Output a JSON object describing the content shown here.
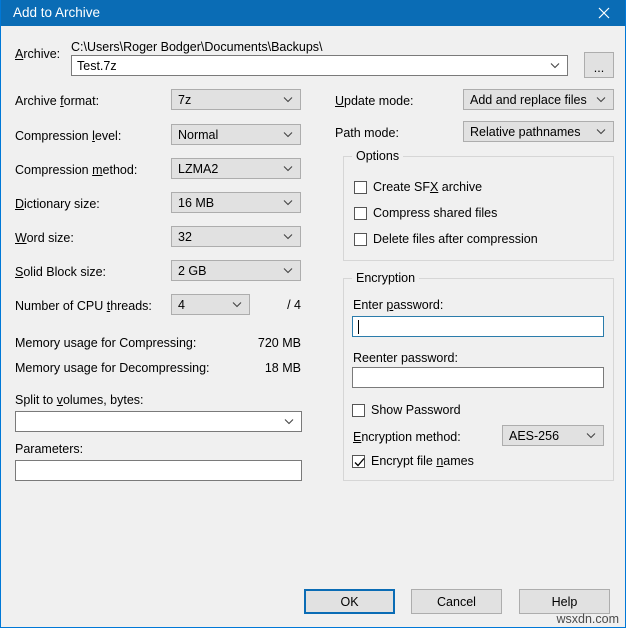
{
  "window": {
    "title": "Add to Archive",
    "close_icon": "close-icon"
  },
  "archive": {
    "label": "Archive:",
    "label_accel": "A",
    "path_text": "C:\\Users\\Roger Bodger\\Documents\\Backups\\",
    "name_value": "Test.7z",
    "browse_label": "..."
  },
  "left_fields": [
    {
      "label_pre": "Archive ",
      "label_accel": "f",
      "label_post": "ormat:",
      "value": "7z"
    },
    {
      "label_pre": "Compression ",
      "label_accel": "l",
      "label_post": "evel:",
      "value": "Normal"
    },
    {
      "label_pre": "Compression ",
      "label_accel": "m",
      "label_post": "ethod:",
      "value": "LZMA2"
    },
    {
      "label_pre": "",
      "label_accel": "D",
      "label_post": "ictionary size:",
      "value": "16 MB"
    },
    {
      "label_pre": "",
      "label_accel": "W",
      "label_post": "ord size:",
      "value": "32"
    },
    {
      "label_pre": "",
      "label_accel": "S",
      "label_post": "olid Block size:",
      "value": "2 GB"
    }
  ],
  "cpu": {
    "label_pre": "Number of CPU ",
    "label_accel": "t",
    "label_post": "hreads:",
    "value": "4",
    "total": "/ 4"
  },
  "memory": {
    "compress_label": "Memory usage for Compressing:",
    "compress_value": "720 MB",
    "decompress_label": "Memory usage for Decompressing:",
    "decompress_value": "18 MB"
  },
  "split": {
    "label_pre": "Split to ",
    "label_accel": "v",
    "label_post": "olumes, bytes:",
    "value": ""
  },
  "parameters": {
    "label": "Parameters:",
    "value": ""
  },
  "update_mode": {
    "label_pre": "",
    "label_accel": "U",
    "label_post": "pdate mode:",
    "value": "Add and replace files"
  },
  "path_mode": {
    "label": "Path mode:",
    "value": "Relative pathnames"
  },
  "options": {
    "title": "Options",
    "items": [
      {
        "label_pre": "Create SF",
        "label_accel": "X",
        "label_post": " archive",
        "checked": false
      },
      {
        "label_pre": "Compress shared files",
        "label_accel": "",
        "label_post": "",
        "checked": false
      },
      {
        "label_pre": "Delete files after compression",
        "label_accel": "",
        "label_post": "",
        "checked": false
      }
    ]
  },
  "encryption": {
    "title": "Encryption",
    "enter_label_pre": "Enter ",
    "enter_label_accel": "p",
    "enter_label_post": "assword:",
    "enter_value": "",
    "reenter_label": "Reenter password:",
    "reenter_value": "",
    "show_password_label": "Show Password",
    "show_password_checked": false,
    "method_label_pre": "",
    "method_label_accel": "E",
    "method_label_post": "ncryption method:",
    "method_value": "AES-256",
    "encrypt_names_pre": "Encrypt file ",
    "encrypt_names_accel": "n",
    "encrypt_names_post": "ames",
    "encrypt_names_checked": true
  },
  "buttons": {
    "ok": "OK",
    "cancel": "Cancel",
    "help": "Help"
  },
  "watermark": "wsxdn.com",
  "colors": {
    "title_bar": "#0a6cb5",
    "dialog_bg": "#f0f0f0",
    "control_bg": "#e1e1e1",
    "focus_border": "#2b7cab",
    "default_button_border": "#0a6cb5"
  }
}
